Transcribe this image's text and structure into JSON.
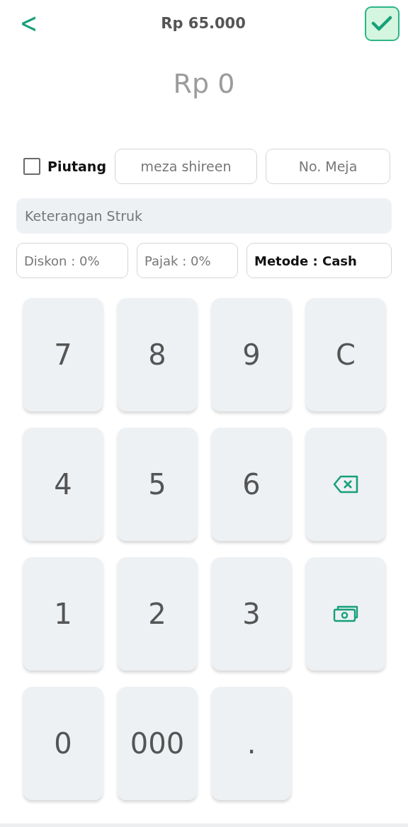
{
  "header": {
    "back": "<",
    "title": "Rp 65.000"
  },
  "amount": "Rp 0",
  "piutang": {
    "label": "Piutang",
    "checked": false
  },
  "customer": {
    "value": "meza shireen"
  },
  "table_no": {
    "placeholder": "No. Meja"
  },
  "note": {
    "placeholder": "Keterangan Struk"
  },
  "options": [
    {
      "label": "Diskon : 0%",
      "set": false
    },
    {
      "label": "Pajak : 0%",
      "set": false
    },
    {
      "label": "Metode : Cash",
      "set": true
    }
  ],
  "keys": [
    {
      "kind": "digit",
      "label": "7"
    },
    {
      "kind": "digit",
      "label": "8"
    },
    {
      "kind": "digit",
      "label": "9"
    },
    {
      "kind": "digit",
      "label": "C"
    },
    {
      "kind": "digit",
      "label": "4"
    },
    {
      "kind": "digit",
      "label": "5"
    },
    {
      "kind": "digit",
      "label": "6"
    },
    {
      "kind": "backspace"
    },
    {
      "kind": "digit",
      "label": "1"
    },
    {
      "kind": "digit",
      "label": "2"
    },
    {
      "kind": "digit",
      "label": "3"
    },
    {
      "kind": "cash"
    },
    {
      "kind": "digit",
      "label": "0"
    },
    {
      "kind": "digit",
      "label": "000"
    },
    {
      "kind": "digit",
      "label": "."
    }
  ]
}
